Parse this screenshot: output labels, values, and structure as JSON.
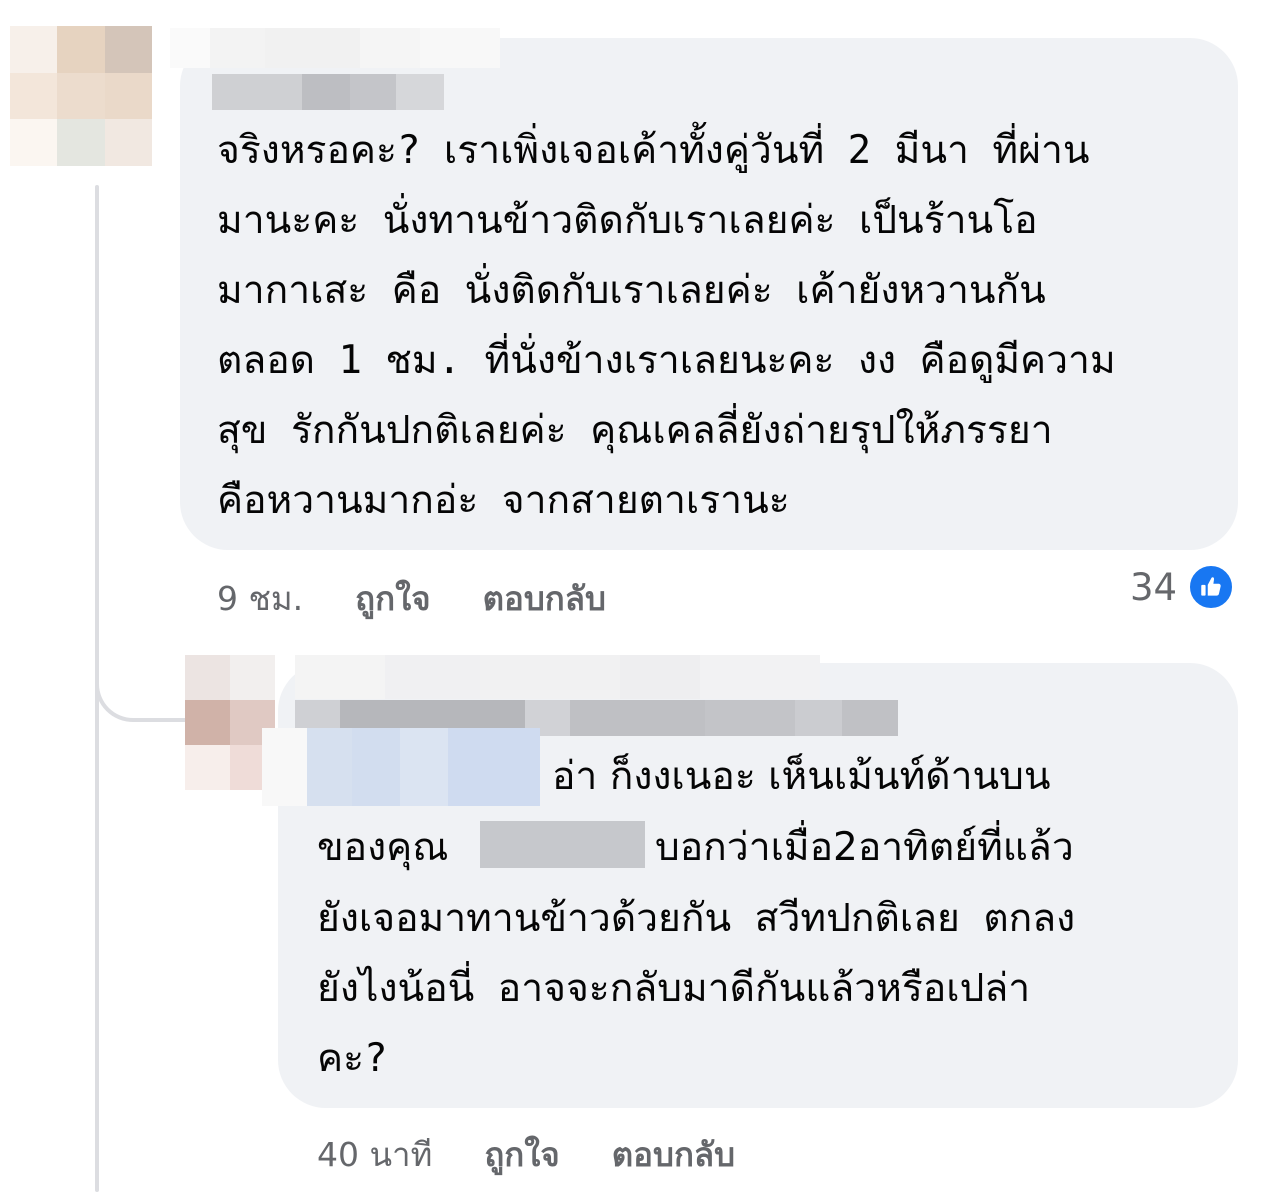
{
  "comment_1": {
    "text": "จริงหรอคะ? เราเพิ่งเจอเค้าทั้งคู่วันที่ 2 มีนา ที่ผ่าน\nมานะคะ นั่งทานข้าวติดกับเราเลยค่ะ เป็นร้านโอ\nมากาเสะ คือ นั่งติดกับเราเลยค่ะ เค้ายังหวานกัน\nตลอด 1 ชม. ที่นั่งข้างเราเลยนะคะ งง คือดูมีความ\nสุข รักกันปกติเลยค่ะ คุณเคลลี่ยังถ่ายรุปให้ภรรยา\nคือหวานมากอ่ะ จากสายตาเรานะ",
    "time": "9 ชม.",
    "like_label": "ถูกใจ",
    "reply_label": "ตอบกลับ",
    "reaction_count": "34",
    "reaction_icon": "thumbs-up-icon"
  },
  "comment_2": {
    "line1": "อ่า ก็งงเนอะ เห็นเม้นท์ด้านบน",
    "line2_prefix": "ของคุณ",
    "line2_suffix": "บอกว่าเมื่อ2อาทิตย์ที่แล้ว",
    "rest": "ยังเจอมาทานข้าวด้วยกัน สวีทปกติเลย ตกลง\nยังไงน้อนี่ อาจจะกลับมาดีกันแล้วหรือเปล่า\nคะ?",
    "time": "40 นาที",
    "like_label": "ถูกใจ",
    "reply_label": "ตอบกลับ"
  },
  "colors": {
    "bubble": "#f0f2f5",
    "meta_text": "#65676b",
    "like_blue": "#1877f2",
    "thread_line": "#dcdde1"
  }
}
